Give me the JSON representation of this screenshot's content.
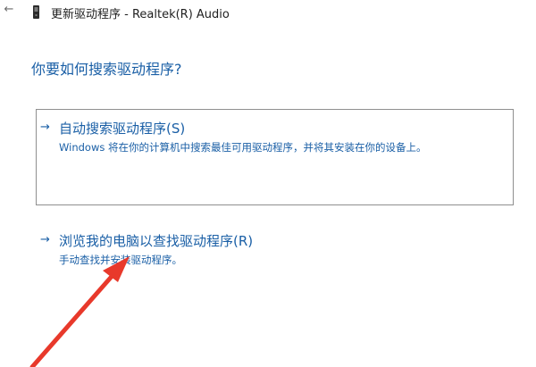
{
  "window": {
    "title": "更新驱动程序 - Realtek(R) Audio"
  },
  "page": {
    "heading": "你要如何搜索驱动程序?"
  },
  "options": [
    {
      "arrow": "→",
      "title": "自动搜索驱动程序(S)",
      "description": "Windows 将在你的计算机中搜索最佳可用驱动程序，并将其安装在你的设备上。"
    },
    {
      "arrow": "→",
      "title": "浏览我的电脑以查找驱动程序(R)",
      "description": "手动查找并安装驱动程序。"
    }
  ],
  "icons": {
    "back": "back-arrow-icon",
    "device": "device-icon"
  },
  "colors": {
    "link": "#1a5fa6",
    "annotation": "#e8392b",
    "border": "#8f8f8f"
  }
}
